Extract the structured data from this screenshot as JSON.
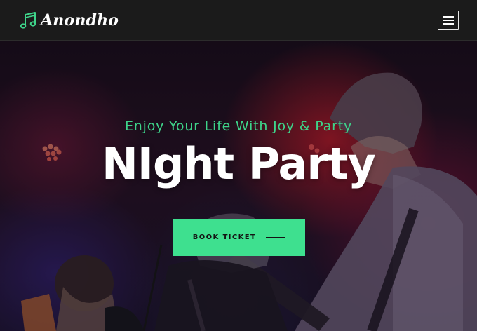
{
  "header": {
    "brand": "Anondho",
    "logo_icon": "music-note-icon",
    "menu_icon": "hamburger-menu-icon"
  },
  "hero": {
    "subtitle": "Enjoy Your Life With Joy & Party",
    "title": "NIght Party",
    "cta_label": "BOOK TICKET",
    "cta_icon": "line-arrow-icon"
  },
  "colors": {
    "accent": "#3ee08f",
    "header_bg": "#1b1b1b",
    "title_text": "#ffffff"
  }
}
